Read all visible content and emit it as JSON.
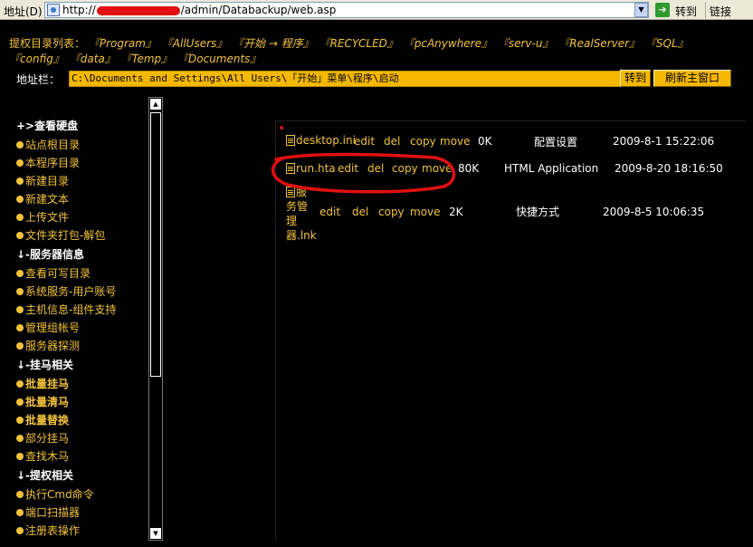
{
  "browser": {
    "address_label": "地址(D)",
    "url_prefix": "http://",
    "url_suffix": "/admin/Databackup/web.asp",
    "go_label": "转到",
    "links_label": "链接"
  },
  "dirs": {
    "label": "提权目录列表：",
    "items": [
      "『Program』",
      "『AllUsers』",
      "『开始 → 程序』",
      "『RECYCLED』",
      "『pcAnywhere』",
      "『serv-u』",
      "『RealServer』",
      "『SQL』",
      "『config』",
      "『data』",
      "『Temp』",
      "『Documents』"
    ]
  },
  "address": {
    "label": "地址栏：",
    "value": "C:\\Documents and Settings\\All Users\\「开始」菜单\\程序\\启动",
    "go_button": "转到",
    "refresh_button": "刷新主窗口"
  },
  "menu": {
    "sections": [
      {
        "heading": "+>查看硬盘",
        "items": [
          "站点根目录",
          "本程序目录",
          "新建目录",
          "新建文本",
          "上传文件",
          "文件夹打包-解包"
        ]
      },
      {
        "heading": "↓-服务器信息",
        "items": [
          "查看可写目录",
          "系统服务-用户账号",
          "主机信息-组件支持",
          "管理组帐号",
          "服务器探测"
        ]
      },
      {
        "heading": "↓-挂马相关",
        "items": [
          "批量挂马",
          "批量清马",
          "批量替换",
          "部分挂马",
          "查找木马"
        ]
      },
      {
        "heading": "↓-提权相关",
        "items": [
          "执行Cmd命令",
          "端口扫描器",
          "注册表操作"
        ]
      }
    ]
  },
  "files": {
    "actions": [
      "edit",
      "del",
      "copy",
      "move"
    ],
    "rows": [
      {
        "name": "desktop.ini",
        "size": "0K",
        "type": "配置设置",
        "time": "2009-8-1 15:22:06"
      },
      {
        "name": "run.hta",
        "size": "80K",
        "type": "HTML Application",
        "time": "2009-8-20 18:16:50"
      },
      {
        "name_lines": [
          "服",
          "务管",
          "理",
          "器.lnk"
        ],
        "size": "2K",
        "type": "快捷方式",
        "time": "2009-8-5 10:06:35"
      }
    ]
  },
  "colors": {
    "accent": "#f2c23a",
    "background": "#000000",
    "annotation": "#e01010",
    "input_bg": "#f5b800"
  }
}
